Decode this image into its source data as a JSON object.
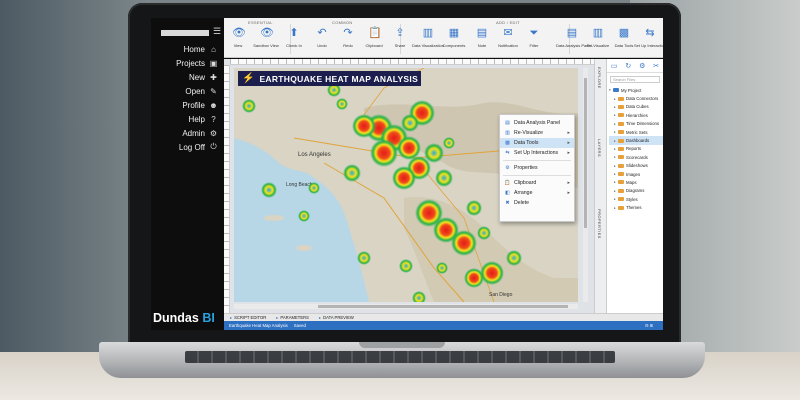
{
  "nav": {
    "items": [
      {
        "label": "Home",
        "icon": "home-icon",
        "glyph": "⌂"
      },
      {
        "label": "Projects",
        "icon": "projects-icon",
        "glyph": "▣"
      },
      {
        "label": "New",
        "icon": "new-icon",
        "glyph": "✚"
      },
      {
        "label": "Open",
        "icon": "open-icon",
        "glyph": "✎"
      },
      {
        "label": "Profile",
        "icon": "profile-icon",
        "glyph": "☻"
      },
      {
        "label": "Help",
        "icon": "help-icon",
        "glyph": "?"
      },
      {
        "label": "Admin",
        "icon": "admin-icon",
        "glyph": "⚙"
      },
      {
        "label": "Log Off",
        "icon": "logoff-icon",
        "glyph": "⏻"
      }
    ],
    "brand_main": "Dundas ",
    "brand_accent": "BI"
  },
  "ribbon": {
    "groups": {
      "essential": "ESSENTIAL",
      "common": "COMMON",
      "add_edit": "ADD / EDIT"
    },
    "buttons": [
      {
        "label": "View",
        "glyph": "👁"
      },
      {
        "label": "Sandbox View",
        "glyph": "👁"
      },
      {
        "label": "Check In",
        "glyph": "⬆"
      },
      {
        "label": "Undo",
        "glyph": "↶"
      },
      {
        "label": "Redo",
        "glyph": "↷"
      },
      {
        "label": "Clipboard",
        "glyph": "📋"
      },
      {
        "label": "Share",
        "glyph": "⇪"
      },
      {
        "label": "Data Visualization",
        "glyph": "▥"
      },
      {
        "label": "Components",
        "glyph": "▦"
      },
      {
        "label": "Note",
        "glyph": "▤"
      },
      {
        "label": "Notification",
        "glyph": "✉"
      },
      {
        "label": "Filter",
        "glyph": "⏷"
      },
      {
        "label": "Data Analysis Panel",
        "glyph": "▤"
      },
      {
        "label": "Re-Visualize",
        "glyph": "▥"
      },
      {
        "label": "Data Tools",
        "glyph": "▩"
      },
      {
        "label": "Set Up Interactions",
        "glyph": "⇆"
      }
    ]
  },
  "dashboard": {
    "title": "EARTHQUAKE HEAT MAP ANALYSIS"
  },
  "map_labels": [
    "Los Angeles",
    "Long Beach",
    "San Diego"
  ],
  "context_menu": {
    "items": [
      {
        "label": "Data Analysis Panel",
        "glyph": "▤",
        "submenu": false,
        "selected": false
      },
      {
        "label": "Re-Visualize",
        "glyph": "▥",
        "submenu": true,
        "selected": false
      },
      {
        "label": "Data Tools",
        "glyph": "▩",
        "submenu": true,
        "selected": true
      },
      {
        "label": "Set Up Interactions",
        "glyph": "⇆",
        "submenu": true,
        "selected": false
      },
      {
        "label": "Properties",
        "glyph": "⚙",
        "submenu": false,
        "selected": false
      },
      {
        "label": "Clipboard",
        "glyph": "📋",
        "submenu": true,
        "selected": false
      },
      {
        "label": "Arrange",
        "glyph": "◧",
        "submenu": true,
        "selected": false
      },
      {
        "label": "Delete",
        "glyph": "✖",
        "submenu": false,
        "selected": false
      }
    ]
  },
  "side_tabs": [
    "EXPLORE",
    "LAYERS",
    "PROPERTIES"
  ],
  "explorer": {
    "search_placeholder": "Search Files",
    "root": "My Project",
    "items": [
      "Data Connectors",
      "Data Cubes",
      "Hierarchies",
      "Time Dimensions",
      "Metric Sets",
      "Dashboards",
      "Reports",
      "Scorecards",
      "Slideshows",
      "Images",
      "Maps",
      "Diagrams",
      "Styles",
      "Themes"
    ],
    "selected": "Dashboards",
    "folder_color": "#e6a13a"
  },
  "bottom_tabs": [
    "SCRIPT EDITOR",
    "PARAMETERS",
    "DATA PREVIEW"
  ],
  "status": {
    "name": "Earthquake Heat Map Analysis",
    "state": "Saved"
  },
  "colors": {
    "accent": "#2d6fc0",
    "title_bar": "#1c1f4d",
    "heat_core": "#e41b1b",
    "heat_mid": "#f5e21c",
    "heat_outer": "#27b24a",
    "ocean": "#b8d7e6"
  }
}
